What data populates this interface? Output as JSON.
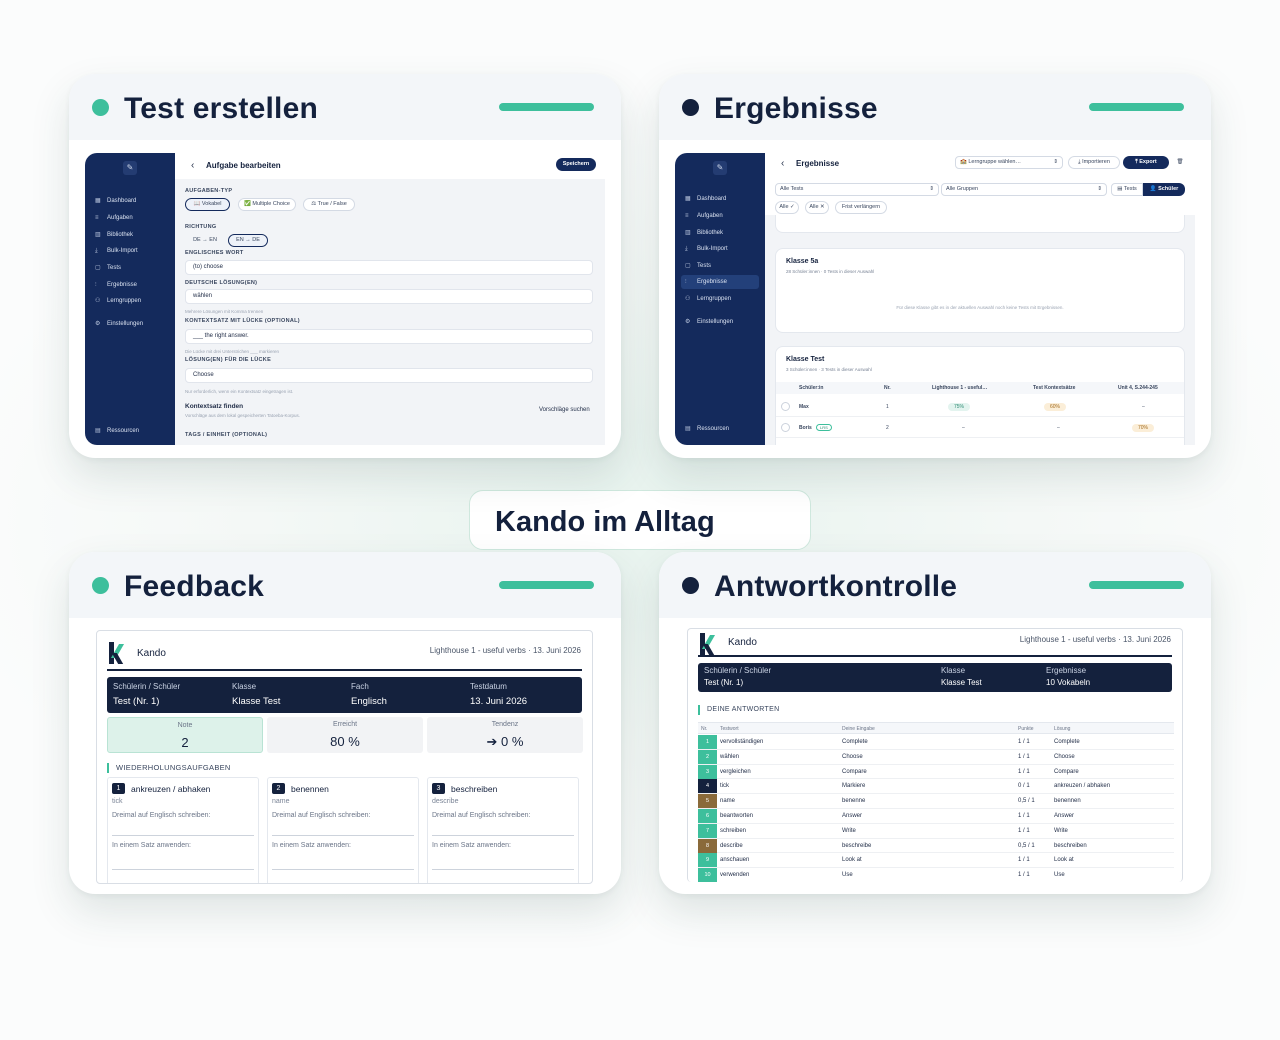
{
  "center": {
    "label": "Kando im Alltag"
  },
  "colors": {
    "accent": "#3dbf9c",
    "navy": "#14213d",
    "sidebar": "#142a5c"
  },
  "cards": {
    "test": {
      "title": "Test erstellen"
    },
    "results": {
      "title": "Ergebnisse"
    },
    "feedback": {
      "title": "Feedback"
    },
    "answers": {
      "title": "Antwortkontrolle"
    }
  },
  "sidebar": {
    "items": [
      {
        "label": "Dashboard",
        "icon": "dashboard-icon"
      },
      {
        "label": "Aufgaben",
        "icon": "list-icon"
      },
      {
        "label": "Bibliothek",
        "icon": "book-icon"
      },
      {
        "label": "Bulk-Import",
        "icon": "import-icon"
      },
      {
        "label": "Tests",
        "icon": "clipboard-icon"
      },
      {
        "label": "Ergebnisse",
        "icon": "chart-icon"
      },
      {
        "label": "Lerngruppen",
        "icon": "users-icon"
      },
      {
        "label": "Einstellungen",
        "icon": "gear-icon"
      }
    ],
    "footer": "Ressourcen"
  },
  "editor": {
    "back": "‹",
    "title": "Aufgabe bearbeiten",
    "save": "Speichern",
    "type_label": "AUFGABEN-TYP",
    "types": [
      "📖 Vokabel",
      "✅ Multiple Choice",
      "⚖ True / False"
    ],
    "direction_label": "RICHTUNG",
    "directions": [
      "DE → EN",
      "EN → DE"
    ],
    "en_label": "ENGLISCHES WORT",
    "en_value": "(to) choose",
    "de_label": "DEUTSCHE LÖSUNG(EN)",
    "de_value": "wählen",
    "de_hint": "Mehrere Lösungen mit Komma trennen",
    "ctx_label": "KONTEXTSATZ MIT LÜCKE (OPTIONAL)",
    "ctx_value": "___ the right answer.",
    "ctx_hint": "Die Lücke mit drei Unterstrichen ___ markieren",
    "gap_label": "LÖSUNG(EN) FÜR DIE LÜCKE",
    "gap_value": "Choose",
    "gap_hint": "Nur erforderlich, wenn ein Kontextsatz eingetragen ist.",
    "find_title": "Kontextsatz finden",
    "find_hint": "Vorschläge aus dem lokal gespeicherten Tatoeba-Korpus.",
    "find_action": "Vorschläge suchen",
    "tags_label": "TAGS / EINHEIT (OPTIONAL)"
  },
  "results": {
    "back": "‹",
    "title": "Ergebnisse",
    "group_select": "🏫 Lerngruppe wählen…",
    "import": "⤓ Importieren",
    "export": "⤒ Export",
    "trash": "🗑",
    "filter_tests": "Alle Tests",
    "filter_groups": "Alle Gruppen",
    "view_tests": "▤ Tests",
    "view_students": "👤 Schüler",
    "chips": [
      "Alle ✓",
      "Alle ✕",
      "Frist verlängern"
    ],
    "class1": {
      "name": "Klasse 5a",
      "meta": "28 Schüler:innen · 0 Tests in dieser Auswahl",
      "empty": "Für diese Klasse gibt es in der aktuellen Auswahl noch keine Tests mit Ergebnissen."
    },
    "class2": {
      "name": "Klasse Test",
      "meta": "3 Schüler:innen · 3 Tests in dieser Auswahl",
      "columns": [
        "Schüler:in",
        "Nr.",
        "Lighthouse 1 - useful…",
        "Test Kontextsätze",
        "Unit 4, S.244-245"
      ],
      "rows": [
        {
          "name": "Max",
          "badge": "",
          "nr": "1",
          "c1": "75%",
          "c2": "60%",
          "c3": "–"
        },
        {
          "name": "Boris",
          "badge": "LRS",
          "nr": "2",
          "c1": "–",
          "c2": "–",
          "c3": "70%"
        }
      ]
    }
  },
  "feedback": {
    "brand": "Kando",
    "test_info": "Lighthouse 1 - useful verbs · 13. Juni 2026",
    "header": [
      {
        "label": "Schülerin / Schüler",
        "value": "Test (Nr. 1)"
      },
      {
        "label": "Klasse",
        "value": "Klasse Test"
      },
      {
        "label": "Fach",
        "value": "Englisch"
      },
      {
        "label": "Testdatum",
        "value": "13. Juni 2026"
      }
    ],
    "metrics": [
      {
        "label": "Note",
        "value": "2"
      },
      {
        "label": "Erreicht",
        "value": "80 %"
      },
      {
        "label": "Tendenz",
        "value": "➔ 0 %"
      }
    ],
    "section": "WIEDERHOLUNGSAUFGABEN",
    "tasks": [
      {
        "num": "1",
        "word": "ankreuzen / abhaken",
        "solution": "tick",
        "prompt1": "Dreimal auf Englisch schreiben:",
        "prompt2": "In einem Satz anwenden:"
      },
      {
        "num": "2",
        "word": "benennen",
        "solution": "name",
        "prompt1": "Dreimal auf Englisch schreiben:",
        "prompt2": "In einem Satz anwenden:"
      },
      {
        "num": "3",
        "word": "beschreiben",
        "solution": "describe",
        "prompt1": "Dreimal auf Englisch schreiben:",
        "prompt2": "In einem Satz anwenden:"
      }
    ]
  },
  "answers": {
    "brand": "Kando",
    "test_info": "Lighthouse 1 - useful verbs · 13. Juni 2026",
    "header": [
      {
        "label": "Schülerin / Schüler",
        "value": "Test (Nr. 1)"
      },
      {
        "label": "Klasse",
        "value": "Klasse Test"
      },
      {
        "label": "Ergebnisse",
        "value": "10 Vokabeln"
      }
    ],
    "section": "DEINE ANTWORTEN",
    "columns": [
      "Nr.",
      "Testwort",
      "Deine Eingabe",
      "Punkte",
      "Lösung"
    ],
    "rows": [
      {
        "nr": "1",
        "word": "vervollständigen",
        "input": "Complete",
        "points": "1 / 1",
        "solution": "Complete",
        "status": "correct"
      },
      {
        "nr": "2",
        "word": "wählen",
        "input": "Choose",
        "points": "1 / 1",
        "solution": "Choose",
        "status": "correct"
      },
      {
        "nr": "3",
        "word": "vergleichen",
        "input": "Compare",
        "points": "1 / 1",
        "solution": "Compare",
        "status": "correct"
      },
      {
        "nr": "4",
        "word": "tick",
        "input": "Markiere",
        "points": "0 / 1",
        "solution": "ankreuzen / abhaken",
        "status": "wrong"
      },
      {
        "nr": "5",
        "word": "name",
        "input": "benenne",
        "points": "0,5 / 1",
        "solution": "benennen",
        "status": "partial"
      },
      {
        "nr": "6",
        "word": "beantworten",
        "input": "Answer",
        "points": "1 / 1",
        "solution": "Answer",
        "status": "correct"
      },
      {
        "nr": "7",
        "word": "schreiben",
        "input": "Write",
        "points": "1 / 1",
        "solution": "Write",
        "status": "correct"
      },
      {
        "nr": "8",
        "word": "describe",
        "input": "beschreibe",
        "points": "0,5 / 1",
        "solution": "beschreiben",
        "status": "partial"
      },
      {
        "nr": "9",
        "word": "anschauen",
        "input": "Look at",
        "points": "1 / 1",
        "solution": "Look at",
        "status": "correct"
      },
      {
        "nr": "10",
        "word": "verwenden",
        "input": "Use",
        "points": "1 / 1",
        "solution": "Use",
        "status": "correct"
      }
    ]
  }
}
